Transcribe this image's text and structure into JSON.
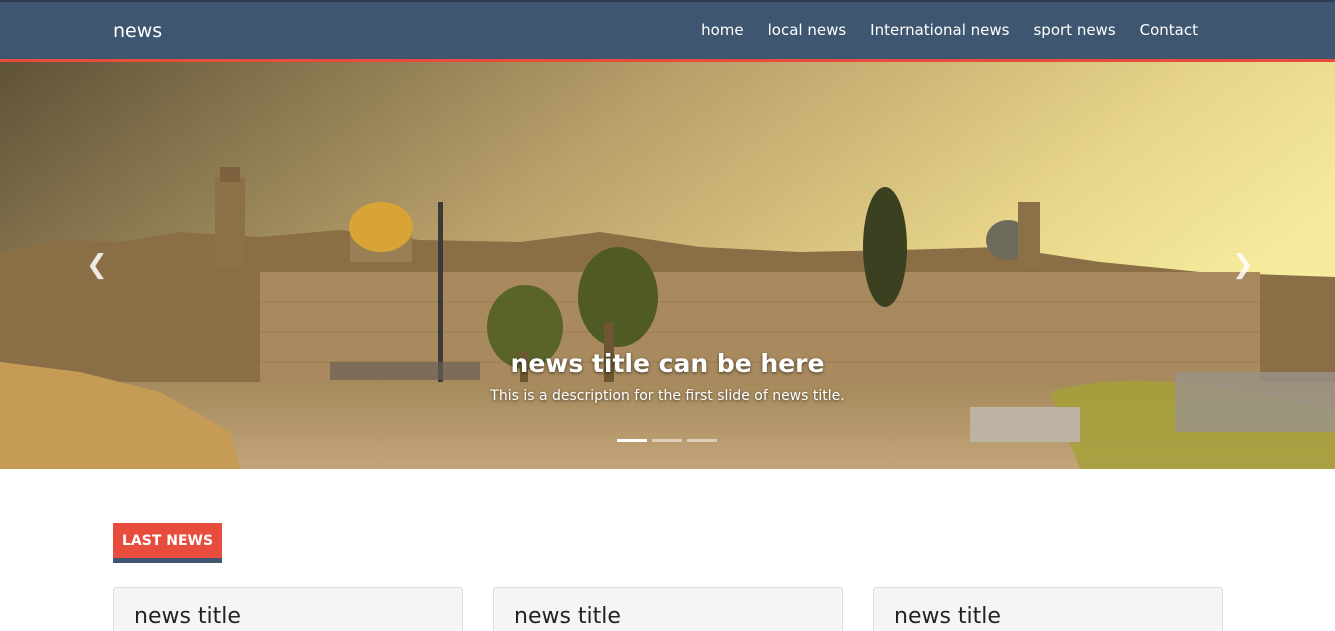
{
  "navbar": {
    "brand": "news",
    "links": [
      "home",
      "local news",
      "International news",
      "sport news",
      "Contact"
    ]
  },
  "carousel": {
    "slide_title": "news title can be here",
    "slide_description": "This is a description for the first slide of news title.",
    "prev_icon": "chevron-left-icon",
    "next_icon": "chevron-right-icon",
    "indicator_count": 3,
    "active_indicator": 1
  },
  "section": {
    "badge_label": "LAST NEWS"
  },
  "cards": [
    {
      "title": "news title"
    },
    {
      "title": "news title"
    },
    {
      "title": "news title"
    }
  ],
  "colors": {
    "navbar_bg": "#3e5670",
    "accent_red": "#e74c3c",
    "card_bg": "#f5f5f5"
  }
}
